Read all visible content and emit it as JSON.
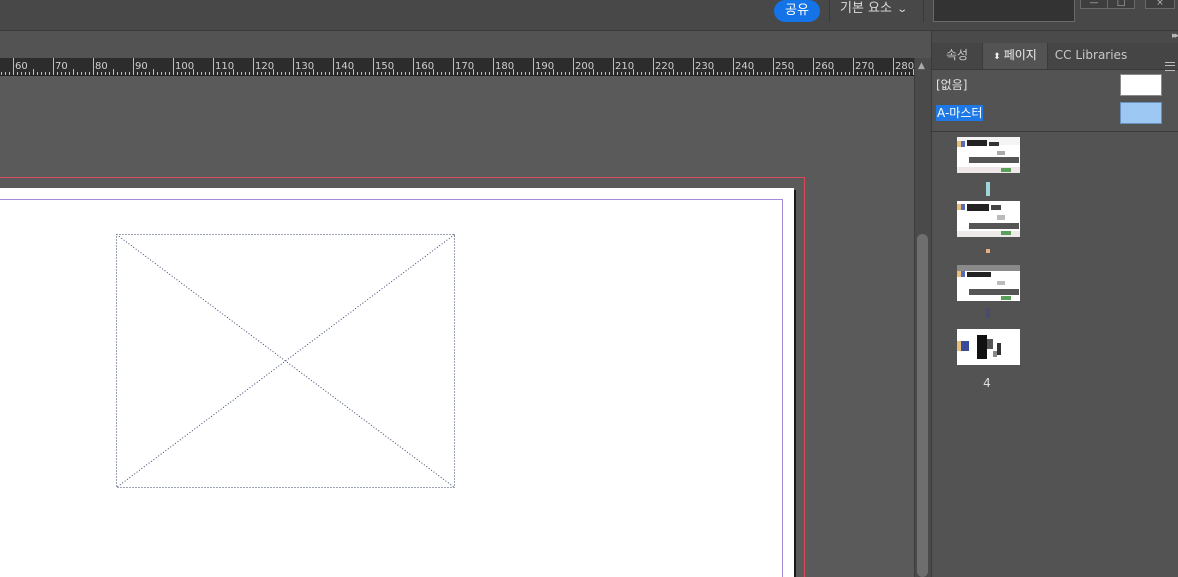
{
  "topbar": {
    "share_label": "공유",
    "workspace_label": "기본 요소",
    "workspace_chevron": "⌄",
    "search": {
      "value": "",
      "placeholder": ""
    }
  },
  "ruler": {
    "units": "mm",
    "ticks": [
      "60",
      "70",
      "80",
      "90",
      "100",
      "110",
      "120",
      "130",
      "140",
      "150",
      "160",
      "170",
      "180",
      "190",
      "200",
      "210",
      "220",
      "230",
      "240",
      "250",
      "260",
      "270",
      "280"
    ]
  },
  "panel": {
    "tabs": [
      {
        "label": "속성",
        "active": false
      },
      {
        "label": "페이지",
        "active": true,
        "dropdown_icon": "⬍"
      },
      {
        "label": "CC Libraries",
        "active": false
      }
    ],
    "masters": [
      {
        "label": "[없음]",
        "selected": false
      },
      {
        "label": "A-마스터",
        "selected": true
      }
    ],
    "pages": [
      {
        "label": ""
      },
      {
        "label": ""
      },
      {
        "label": ""
      },
      {
        "label": "4"
      }
    ]
  },
  "colors": {
    "accent": "#1473e6",
    "bleed_guide": "#d84a5a",
    "margin_guide": "#a58ad8",
    "selection": "#1e78e6"
  },
  "icons": {
    "panel_collapse": "double-chevron-right-icon",
    "panel_menu": "hamburger-icon",
    "scroll_up": "triangle-up-icon"
  }
}
